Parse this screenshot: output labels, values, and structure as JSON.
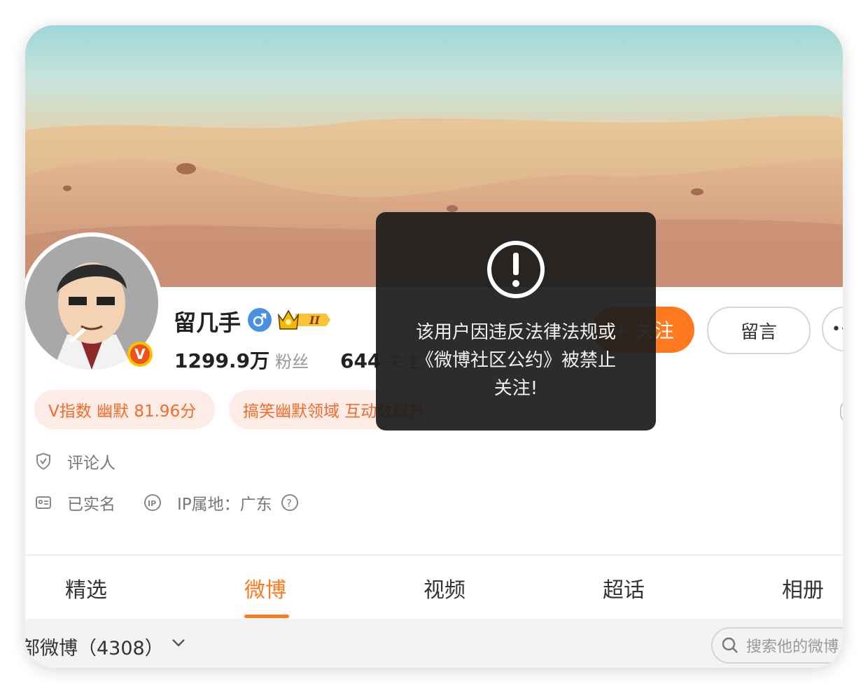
{
  "profile": {
    "name": "留几手",
    "fans_count": "1299.9万",
    "fans_label": "粉丝",
    "follow_count": "644",
    "follow_label": "关注",
    "level_badge": "II"
  },
  "actions": {
    "follow_label": "+ 关注",
    "message_label": "留言",
    "more_label": "•·"
  },
  "tags": [
    {
      "text": "V指数 幽默 81.96分"
    },
    {
      "text": "搞笑幽默领域 互动数飙升"
    }
  ],
  "info": {
    "role": "评论人",
    "verified": "已实名",
    "ip_location": "IP属地：广东"
  },
  "tabs": [
    {
      "label": "精选"
    },
    {
      "label": "微博"
    },
    {
      "label": "视频"
    },
    {
      "label": "超话"
    },
    {
      "label": "相册"
    }
  ],
  "active_tab": "微博",
  "filter": {
    "label": "部微博（4308）",
    "search_placeholder": "搜索他的微博"
  },
  "toast": {
    "message": "该用户因违反法律法规或《微博社区公约》被禁止关注!"
  },
  "colors": {
    "accent": "#ff7a1f",
    "tag_bg": "#fdece6",
    "tag_text": "#f26b2c",
    "toast_bg": "#1c1c1c"
  },
  "icons": {
    "verified": "male-icon",
    "crown": "crown-icon",
    "alert": "alert-circle-icon",
    "shield": "shield-check-icon",
    "id_card": "id-card-icon",
    "ip": "ip-icon",
    "help": "question-circle-icon",
    "search": "search-icon",
    "chevron": "chevron-down-icon"
  }
}
